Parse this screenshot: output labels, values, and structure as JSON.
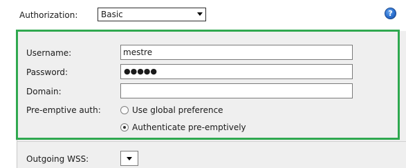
{
  "authorization": {
    "label": "Authorization:",
    "selected": "Basic",
    "dropdown_icon": "chevron-down-icon"
  },
  "help": {
    "icon": "help-icon",
    "glyph": "?"
  },
  "credentials": {
    "username_label": "Username:",
    "username_value": "mestre",
    "password_label": "Password:",
    "password_mask": "●●●●●",
    "domain_label": "Domain:",
    "domain_value": "",
    "preemptive_label": "Pre-emptive auth:",
    "options": [
      {
        "label": "Use global preference",
        "selected": false
      },
      {
        "label": "Authenticate pre-emptively",
        "selected": true
      }
    ]
  },
  "outgoing_wss": {
    "label": "Outgoing WSS:",
    "selected": "",
    "dropdown_icon": "chevron-down-icon"
  },
  "colors": {
    "highlight_frame": "#2fa84f",
    "panel_background": "#efefef",
    "help_icon": "#2a6fcf"
  }
}
